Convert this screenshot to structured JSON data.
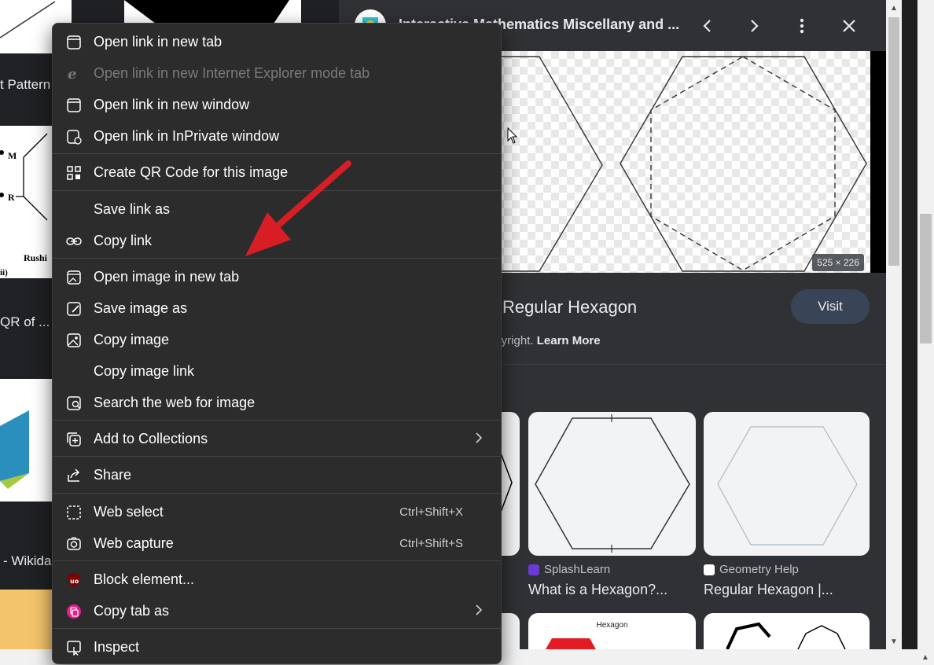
{
  "background": {
    "left_texts": [
      "t Pattern",
      "QR of ...",
      "- Wikida"
    ],
    "left_figure_labels": [
      "M",
      "R",
      "Rushi",
      "ii)"
    ]
  },
  "panel": {
    "title": "Interactive Mathematics Miscellany and ...",
    "image_size": "525 × 226",
    "result_title": "ff Regular Hexagon",
    "copyright_prefix": "opyright.",
    "learn_more": "Learn More",
    "visit_label": "Visit",
    "related": [
      {
        "source": "",
        "caption": "..."
      },
      {
        "source": "SplashLearn",
        "caption": "What is a Hexagon?..."
      },
      {
        "source": "Geometry Help",
        "caption": "Regular Hexagon |..."
      }
    ],
    "bottom_thumb_label": "Hexagon"
  },
  "menu": {
    "items": [
      {
        "label": "Open link in new tab",
        "icon": "new-tab-icon",
        "disabled": false
      },
      {
        "label": "Open link in new Internet Explorer mode tab",
        "icon": "ie-icon",
        "disabled": true
      },
      {
        "label": "Open link in new window",
        "icon": "new-window-icon",
        "disabled": false
      },
      {
        "label": "Open link in InPrivate window",
        "icon": "inprivate-icon",
        "disabled": false
      },
      {
        "label": "Create QR Code for this image",
        "icon": "qr-code-icon",
        "disabled": false
      },
      {
        "label": "Save link as",
        "icon": "",
        "disabled": false
      },
      {
        "label": "Copy link",
        "icon": "link-icon",
        "disabled": false
      },
      {
        "label": "Open image in new tab",
        "icon": "image-new-tab-icon",
        "disabled": false
      },
      {
        "label": "Save image as",
        "icon": "save-image-icon",
        "disabled": false
      },
      {
        "label": "Copy image",
        "icon": "image-icon",
        "disabled": false
      },
      {
        "label": "Copy image link",
        "icon": "",
        "disabled": false
      },
      {
        "label": "Search the web for image",
        "icon": "visual-search-icon",
        "disabled": false
      },
      {
        "label": "Add to Collections",
        "icon": "collections-icon",
        "disabled": false
      },
      {
        "label": "Share",
        "icon": "share-icon",
        "disabled": false
      },
      {
        "label": "Web select",
        "icon": "web-select-icon",
        "shortcut": "Ctrl+Shift+X",
        "disabled": false
      },
      {
        "label": "Web capture",
        "icon": "web-capture-icon",
        "shortcut": "Ctrl+Shift+S",
        "disabled": false
      },
      {
        "label": "Block element...",
        "icon": "ublock-icon",
        "disabled": false
      },
      {
        "label": "Copy tab as",
        "icon": "copy-tab-extension-icon",
        "disabled": false
      },
      {
        "label": "Inspect",
        "icon": "inspect-icon",
        "disabled": false
      }
    ]
  },
  "colors": {
    "menu_bg": "#2c2c2c",
    "panel_bg": "#303134",
    "visit_bg": "#394457",
    "arrow_red": "#d81e25",
    "ublock_red": "#800000",
    "copytab_pink": "#e91e8c"
  }
}
